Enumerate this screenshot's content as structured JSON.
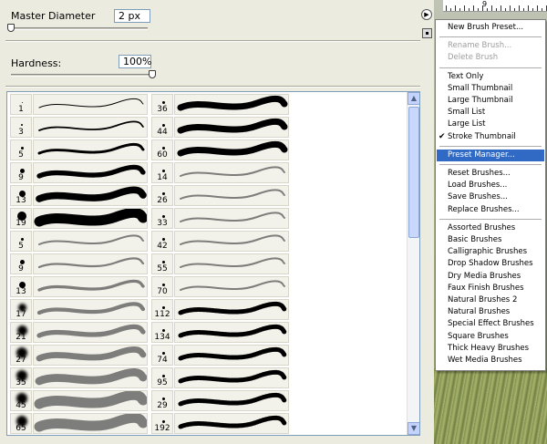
{
  "master_diameter": {
    "label": "Master Diameter",
    "value": "2 px",
    "level": 0.0
  },
  "hardness": {
    "label": "Hardness:",
    "value": "100%",
    "level": 1.0
  },
  "brushes_left": [
    {
      "num": "1"
    },
    {
      "num": "3"
    },
    {
      "num": "5"
    },
    {
      "num": "9"
    },
    {
      "num": "13"
    },
    {
      "num": "19"
    },
    {
      "num": "5"
    },
    {
      "num": "9"
    },
    {
      "num": "13"
    },
    {
      "num": "17"
    },
    {
      "num": "21"
    },
    {
      "num": "27"
    },
    {
      "num": "35"
    },
    {
      "num": "45"
    },
    {
      "num": "65"
    }
  ],
  "brushes_right": [
    {
      "num": "36"
    },
    {
      "num": "44"
    },
    {
      "num": "60"
    },
    {
      "num": "14"
    },
    {
      "num": "26"
    },
    {
      "num": "33"
    },
    {
      "num": "42"
    },
    {
      "num": "55"
    },
    {
      "num": "70"
    },
    {
      "num": "112"
    },
    {
      "num": "134"
    },
    {
      "num": "74"
    },
    {
      "num": "95"
    },
    {
      "num": "29"
    },
    {
      "num": "192"
    }
  ],
  "ruler": {
    "label": "9"
  },
  "menu": {
    "items": [
      {
        "label": "New Brush Preset...",
        "state": "normal"
      },
      {
        "sep": true
      },
      {
        "label": "Rename Brush...",
        "state": "disabled"
      },
      {
        "label": "Delete Brush",
        "state": "disabled"
      },
      {
        "sep": true
      },
      {
        "label": "Text Only",
        "state": "normal"
      },
      {
        "label": "Small Thumbnail",
        "state": "normal"
      },
      {
        "label": "Large Thumbnail",
        "state": "normal"
      },
      {
        "label": "Small List",
        "state": "normal"
      },
      {
        "label": "Large List",
        "state": "normal"
      },
      {
        "label": "Stroke Thumbnail",
        "state": "checked"
      },
      {
        "sep": true
      },
      {
        "label": "Preset Manager...",
        "state": "selected"
      },
      {
        "sep": true
      },
      {
        "label": "Reset Brushes...",
        "state": "normal"
      },
      {
        "label": "Load Brushes...",
        "state": "normal"
      },
      {
        "label": "Save Brushes...",
        "state": "normal"
      },
      {
        "label": "Replace Brushes...",
        "state": "normal"
      },
      {
        "sep": true
      },
      {
        "label": "Assorted Brushes",
        "state": "normal"
      },
      {
        "label": "Basic Brushes",
        "state": "normal"
      },
      {
        "label": "Calligraphic Brushes",
        "state": "normal"
      },
      {
        "label": "Drop Shadow Brushes",
        "state": "normal"
      },
      {
        "label": "Dry Media Brushes",
        "state": "normal"
      },
      {
        "label": "Faux Finish Brushes",
        "state": "normal"
      },
      {
        "label": "Natural Brushes 2",
        "state": "normal"
      },
      {
        "label": "Natural Brushes",
        "state": "normal"
      },
      {
        "label": "Special Effect Brushes",
        "state": "normal"
      },
      {
        "label": "Square Brushes",
        "state": "normal"
      },
      {
        "label": "Thick Heavy Brushes",
        "state": "normal"
      },
      {
        "label": "Wet Media Brushes",
        "state": "normal"
      }
    ]
  },
  "colors": {
    "selection": "#316ac5",
    "panel": "#ecebe0"
  }
}
